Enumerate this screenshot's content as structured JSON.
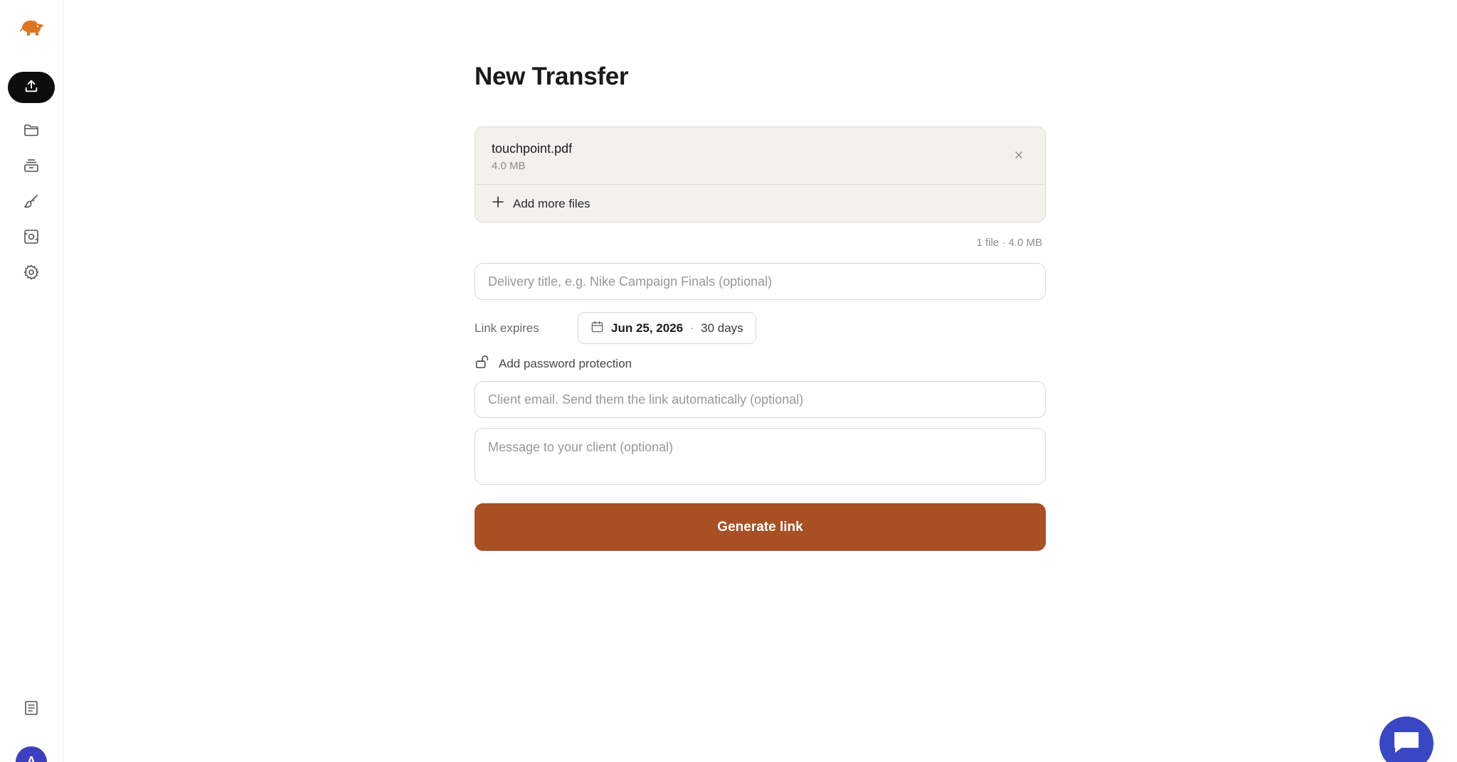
{
  "app": {
    "logo_icon": "elephant-logo-icon",
    "accent_color": "#a84f24",
    "active_nav_color": "#0d0d0d"
  },
  "sidebar": {
    "items": [
      {
        "icon": "upload-icon",
        "active": true
      },
      {
        "icon": "folder-icon",
        "active": false
      },
      {
        "icon": "archive-icon",
        "active": false
      },
      {
        "icon": "brush-icon",
        "active": false
      },
      {
        "icon": "camera-icon",
        "active": false
      },
      {
        "icon": "gear-icon",
        "active": false
      }
    ],
    "bottom_icon": "document-icon",
    "avatar_initial": "A"
  },
  "page": {
    "title": "New Transfer"
  },
  "files": {
    "items": [
      {
        "name": "touchpoint.pdf",
        "size": "4.0 MB"
      }
    ],
    "add_more_label": "Add more files",
    "summary": "1 file · 4.0 MB"
  },
  "form": {
    "delivery_title_placeholder": "Delivery title, e.g. Nike Campaign Finals (optional)",
    "expires_label": "Link expires",
    "expires_date": "Jun 25, 2026",
    "expires_separator": "·",
    "expires_duration": "30 days",
    "password_label": "Add password protection",
    "client_email_placeholder": "Client email. Send them the link automatically (optional)",
    "message_placeholder": "Message to your client (optional)",
    "submit_label": "Generate link"
  },
  "chat": {
    "icon": "chat-icon",
    "color": "#3a47c4"
  }
}
